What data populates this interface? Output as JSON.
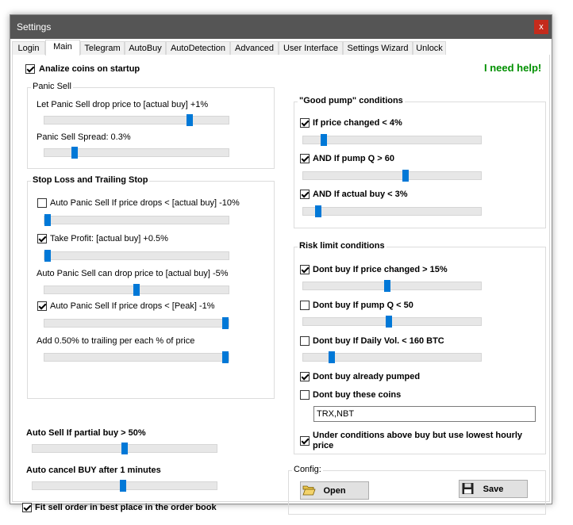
{
  "window": {
    "title": "Settings",
    "close_label": "x"
  },
  "tabs": [
    {
      "label": "Login",
      "active": false
    },
    {
      "label": "Main",
      "active": true
    },
    {
      "label": "Telegram",
      "active": false
    },
    {
      "label": "AutoBuy",
      "active": false
    },
    {
      "label": "AutoDetection",
      "active": false
    },
    {
      "label": "Advanced",
      "active": false
    },
    {
      "label": "User Interface",
      "active": false
    },
    {
      "label": "Settings Wizard",
      "active": false
    },
    {
      "label": "Unlock",
      "active": false
    }
  ],
  "main": {
    "analize": {
      "label": "Analize coins on startup",
      "checked": true
    },
    "help_link": "I need help!",
    "panic_sell": {
      "title": "Panic Sell",
      "drop_label": "Let Panic Sell drop price to [actual buy]  +1%",
      "drop_slider": 0.8,
      "spread_label": "Panic Sell Spread: 0.3%",
      "spread_slider": 0.15
    },
    "stop_loss": {
      "title": "Stop Loss and Trailing Stop",
      "auto_panic": {
        "label": "Auto Panic Sell If price drops < [actual buy]  -10%",
        "checked": false,
        "slider": 0.0
      },
      "take_profit": {
        "label": "Take Profit: [actual buy]  +0.5%",
        "checked": true,
        "slider": 0.0
      },
      "auto_drop_label": "Auto Panic Sell can drop price to [actual buy]  -5%",
      "auto_drop_slider": 0.5,
      "auto_panic_peak": {
        "label": "Auto Panic Sell If price drops < [Peak]  -1%",
        "checked": true,
        "slider": 1.0
      },
      "trailing_label": "Add 0.50% to trailing per each % of price",
      "trailing_slider": 1.0
    },
    "auto_sell": {
      "label": "Auto Sell If partial buy > 50%",
      "slider": 0.5
    },
    "auto_cancel": {
      "label": "Auto cancel BUY after 1 minutes",
      "slider": 0.49
    },
    "fit_sell": {
      "label": "Fit sell order in best place in the order book",
      "checked": true
    },
    "good_pump": {
      "title": "\"Good pump\" conditions",
      "items": [
        {
          "label": "If price changed < 4%",
          "checked": true,
          "slider": 0.1
        },
        {
          "label": "AND If pump Q > 60",
          "checked": true,
          "slider": 0.58
        },
        {
          "label": "AND If actual buy < 3%",
          "checked": true,
          "slider": 0.07
        }
      ]
    },
    "risk": {
      "title": "Risk limit conditions",
      "items": [
        {
          "label": "Dont buy If price changed > 15%",
          "checked": true,
          "slider": 0.47
        },
        {
          "label": "Dont buy If pump Q < 50",
          "checked": false,
          "slider": 0.48
        },
        {
          "label": "Dont buy If Daily Vol. < 160 BTC",
          "checked": false,
          "slider": 0.15
        }
      ],
      "already_pumped": {
        "label": "Dont buy already pumped",
        "checked": true
      },
      "these_coins": {
        "label": "Dont buy these coins",
        "checked": false,
        "value": "TRX,NBT"
      },
      "lowest_hourly": {
        "label": "Under conditions above buy but use lowest hourly price",
        "checked": true
      }
    },
    "config": {
      "title": "Config:",
      "open_label": "Open",
      "save_label": "Save"
    }
  }
}
